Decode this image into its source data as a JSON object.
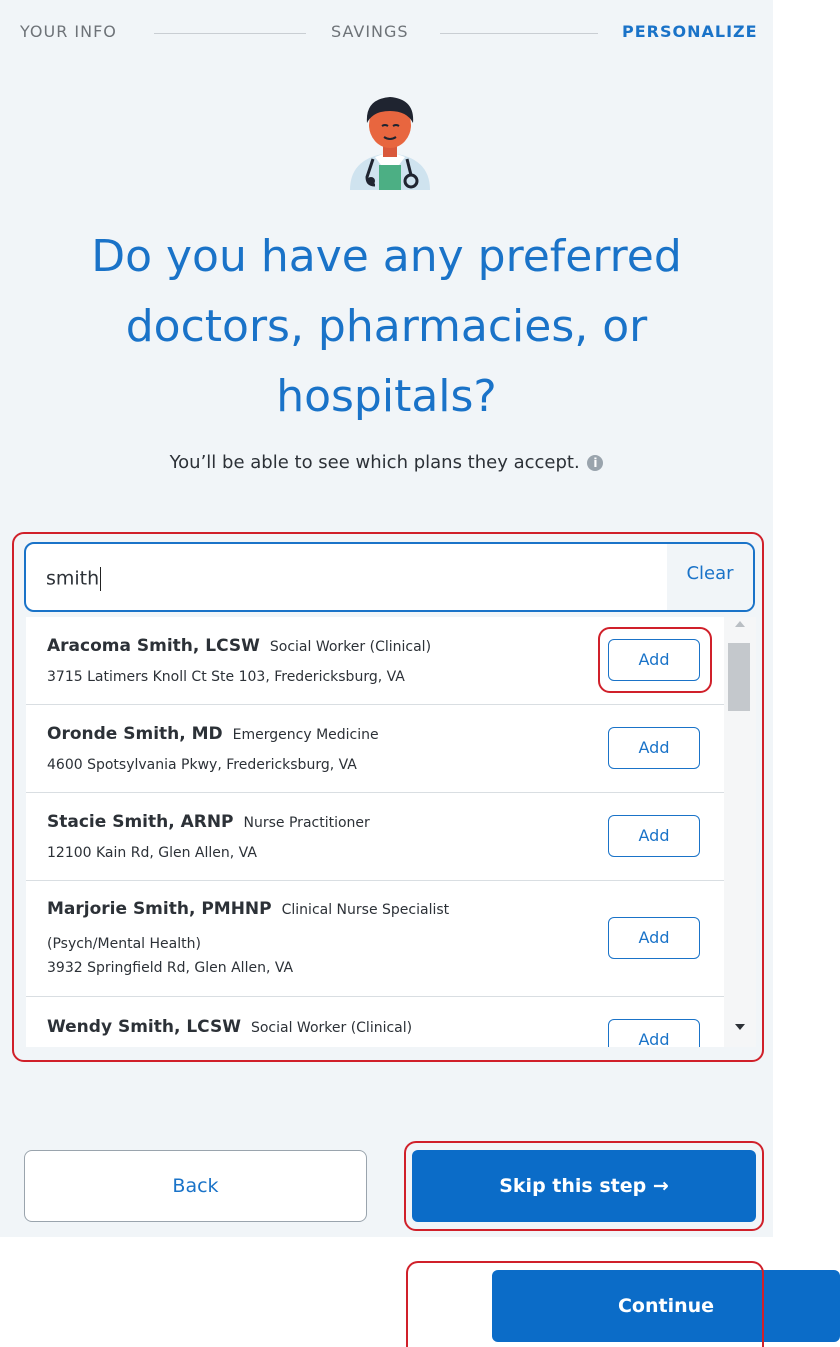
{
  "stepper": {
    "steps": [
      {
        "label": "YOUR INFO",
        "active": false
      },
      {
        "label": "SAVINGS",
        "active": false
      },
      {
        "label": "PERSONALIZE",
        "active": true
      }
    ]
  },
  "avatar": {
    "icon": "doctor-avatar-icon"
  },
  "heading": {
    "line1": "Do you have any preferred",
    "line2": "doctors, pharmacies, or",
    "line3": "hospitals?"
  },
  "subtitle": {
    "text": "You’ll be able to see which plans they accept.",
    "info_icon": "i"
  },
  "search": {
    "value": "smith",
    "clear_label": "Clear"
  },
  "results": [
    {
      "name": "Aracoma Smith, LCSW",
      "specialty": "Social Worker (Clinical)",
      "specialty_line2": "",
      "address": "3715 Latimers Knoll Ct Ste 103, Fredericksburg, VA",
      "button": "Add"
    },
    {
      "name": "Oronde Smith, MD",
      "specialty": "Emergency Medicine",
      "specialty_line2": "",
      "address": "4600 Spotsylvania Pkwy, Fredericksburg, VA",
      "button": "Add"
    },
    {
      "name": "Stacie Smith, ARNP",
      "specialty": "Nurse Practitioner",
      "specialty_line2": "",
      "address": "12100 Kain Rd, Glen Allen, VA",
      "button": "Add"
    },
    {
      "name": "Marjorie Smith, PMHNP",
      "specialty": "Clinical Nurse Specialist",
      "specialty_line2": "(Psych/Mental Health)",
      "address": "3932 Springfield Rd, Glen Allen, VA",
      "button": "Add"
    },
    {
      "name": "Wendy Smith, LCSW",
      "specialty": "Social Worker (Clinical)",
      "specialty_line2": "",
      "address": "",
      "button": "Add"
    }
  ],
  "buttons": {
    "back": "Back",
    "skip": "Skip this step →",
    "continue": "Continue"
  },
  "colors": {
    "accent": "#1a73c8",
    "primary_button": "#0b6cc8",
    "annotation": "#d0202a"
  }
}
